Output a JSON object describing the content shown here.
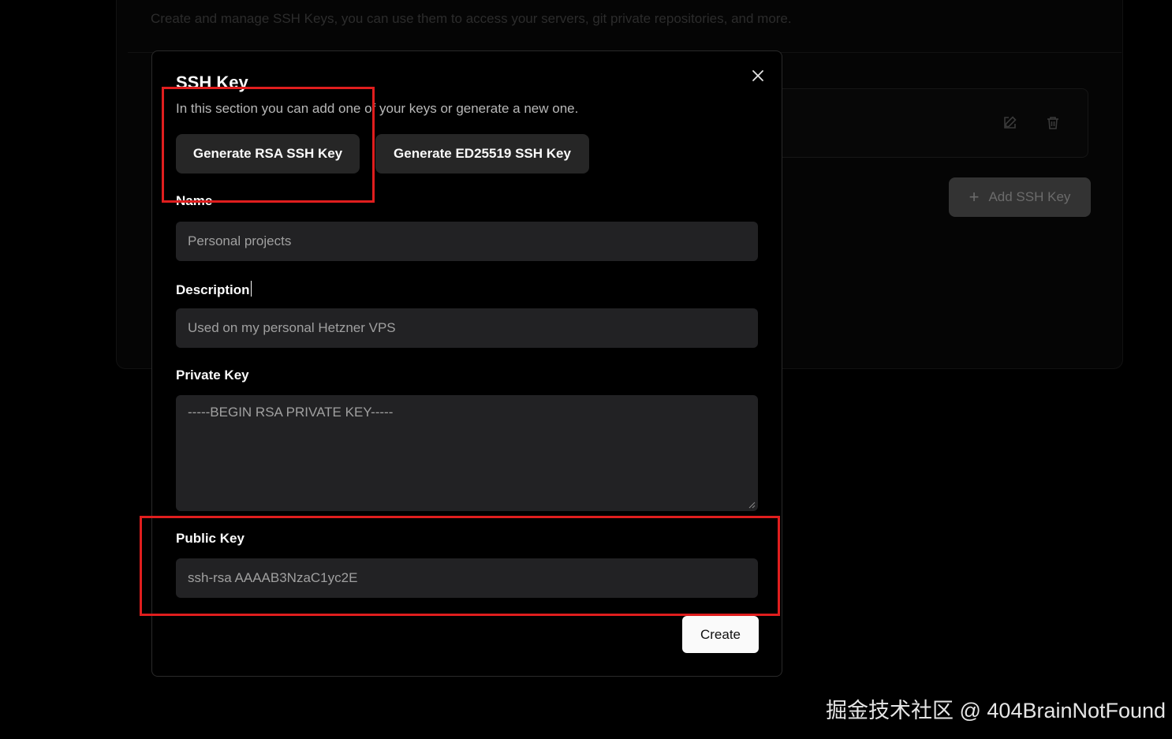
{
  "background": {
    "subtitle": "Create and manage SSH Keys, you can use them to access your servers, git private repositories, and more.",
    "add_button_label": "Add SSH Key",
    "row_icons": [
      "edit-icon",
      "trash-icon"
    ]
  },
  "modal": {
    "title": "SSH Key",
    "description": "In this section you can add one of your keys or generate a new one.",
    "generate_rsa_label": "Generate RSA SSH Key",
    "generate_ed25519_label": "Generate ED25519 SSH Key",
    "fields": {
      "name": {
        "label": "Name",
        "placeholder": "Personal projects"
      },
      "description": {
        "label": "Description",
        "placeholder": "Used on my personal Hetzner VPS"
      },
      "private_key": {
        "label": "Private Key",
        "placeholder": "-----BEGIN RSA PRIVATE KEY-----"
      },
      "public_key": {
        "label": "Public Key",
        "placeholder": "ssh-rsa AAAAB3NzaC1yc2E"
      }
    },
    "create_label": "Create"
  },
  "watermark": "掘金技术社区 @ 404BrainNotFound",
  "colors": {
    "annotation": "#e01e1e",
    "input_bg": "#222224",
    "button_bg": "#262626"
  }
}
